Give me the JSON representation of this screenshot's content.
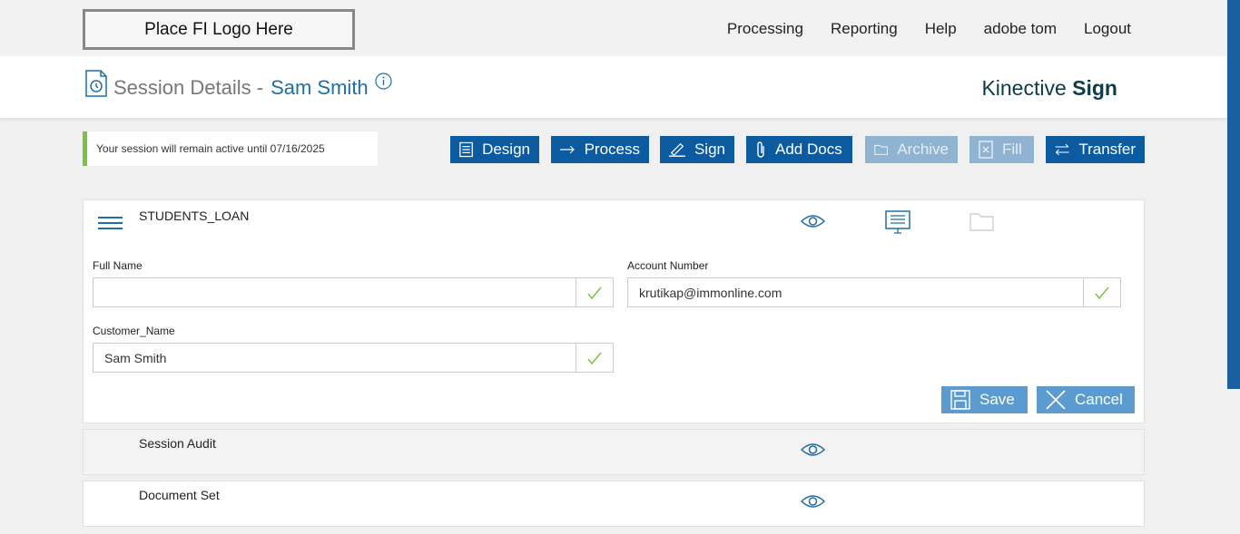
{
  "header": {
    "logo_text": "Place FI Logo Here",
    "nav": [
      "Processing",
      "Reporting",
      "Help",
      "adobe tom",
      "Logout"
    ]
  },
  "page": {
    "title_prefix": "Session Details -",
    "title_name": "Sam Smith",
    "brand_light": "Kinective",
    "brand_bold": "Sign"
  },
  "notice": "Your session will remain active until 07/16/2025",
  "toolbar": {
    "design": "Design",
    "process": "Process",
    "sign": "Sign",
    "add_docs": "Add Docs",
    "archive": "Archive",
    "fill": "Fill",
    "transfer": "Transfer"
  },
  "form_panel": {
    "title": "STUDENTS_LOAN",
    "fields": [
      {
        "label": "Full Name",
        "value": ""
      },
      {
        "label": "Account Number",
        "value": "krutikap@immonline.com"
      },
      {
        "label": "Customer_Name",
        "value": "Sam Smith"
      }
    ],
    "save": "Save",
    "cancel": "Cancel"
  },
  "audit_panel": {
    "title": "Session Audit"
  },
  "docset_panel": {
    "title": "Document Set"
  },
  "colors": {
    "primary": "#0c5aa0",
    "disabled": "#90b3d2",
    "accent_green": "#7cc242",
    "link_blue": "#1f6ea9"
  }
}
